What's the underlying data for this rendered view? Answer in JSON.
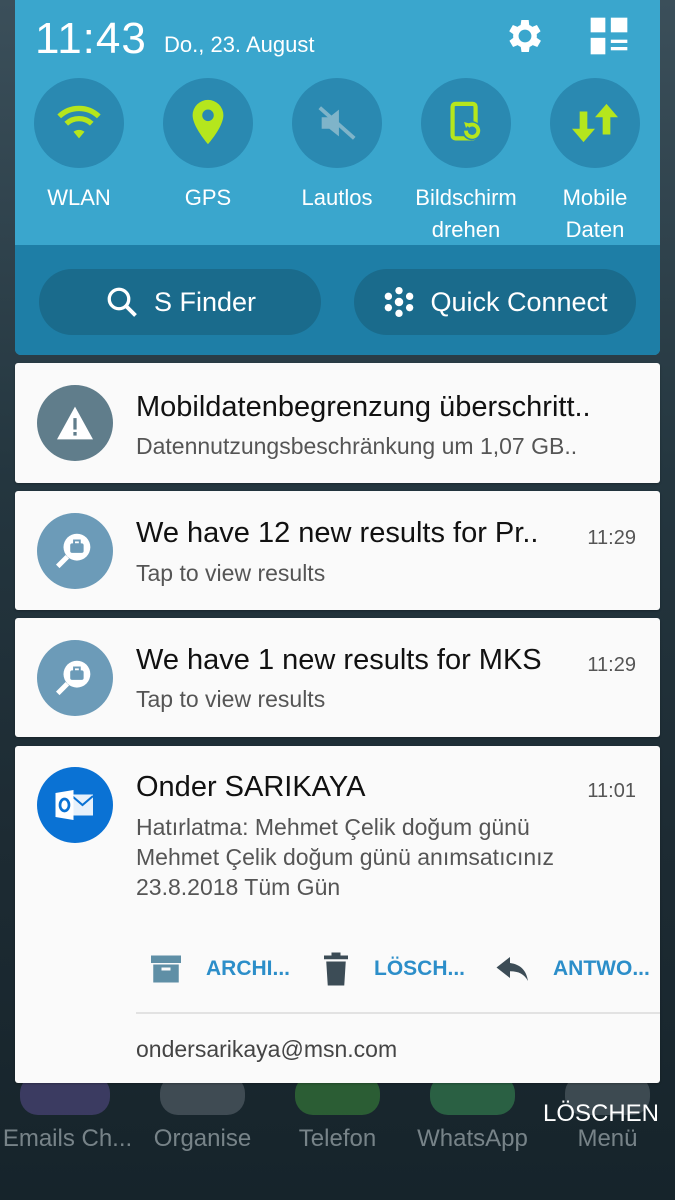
{
  "status": {
    "time": "11:43",
    "date": "Do., 23. August"
  },
  "quick_settings": {
    "toggles": [
      {
        "label": "WLAN",
        "icon": "wifi-icon"
      },
      {
        "label": "GPS",
        "icon": "location-pin-icon"
      },
      {
        "label": "Lautlos",
        "icon": "mute-icon"
      },
      {
        "label": "Bildschirm\ndrehen",
        "icon": "rotate-screen-icon"
      },
      {
        "label": "Mobile\nDaten",
        "icon": "mobile-data-icon"
      }
    ],
    "s_finder": "S Finder",
    "quick_connect": "Quick Connect"
  },
  "notifications": [
    {
      "title": "Mobildatenbegrenzung überschritt..",
      "subtitle": "Datennutzungsbeschränkung um 1,07 GB..",
      "icon": "warning-icon"
    },
    {
      "title": "We have 12 new results for Pr..",
      "time": "11:29",
      "subtitle": "Tap to view results",
      "icon": "job-search-icon"
    },
    {
      "title": "We have 1 new results for MKS",
      "time": "11:29",
      "subtitle": "Tap to view results",
      "icon": "job-search-icon"
    },
    {
      "title": "Onder SARIKAYA",
      "time": "11:01",
      "lines": [
        "Hatırlatma: Mehmet Çelik doğum günü",
        "Mehmet Çelik doğum günü anımsatıcınız",
        "23.8.2018 Tüm Gün"
      ],
      "actions": [
        "ARCHI...",
        "LÖSCH...",
        "ANTWO..."
      ],
      "account": "ondersarikaya@msn.com",
      "icon": "outlook-icon"
    }
  ],
  "clear_all": "LÖSCHEN",
  "dock": [
    "Emails Ch...",
    "Organise",
    "Telefon",
    "WhatsApp",
    "Menü"
  ],
  "colors": {
    "panel": "#3aa6cd",
    "accent_green": "#b5e61d",
    "card": "#fafafa",
    "action_blue": "#2c8ec9",
    "outlook_blue": "#0a72d4"
  }
}
